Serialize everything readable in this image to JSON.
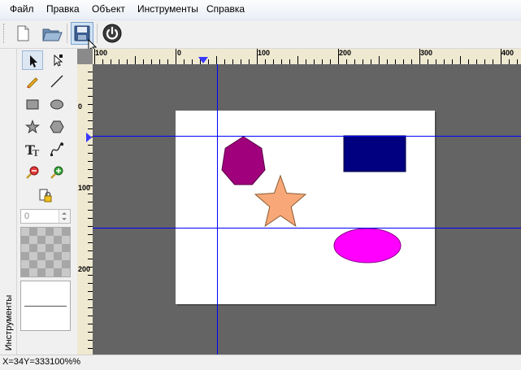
{
  "menu": {
    "items": [
      "Файл",
      "Правка",
      "Объект",
      "Инструменты",
      "Справка"
    ]
  },
  "toolbar": {
    "buttons": [
      {
        "name": "new-document-icon"
      },
      {
        "name": "open-folder-icon"
      },
      {
        "name": "save-icon",
        "state": "hovered"
      },
      {
        "name": "power-icon"
      }
    ]
  },
  "tools_panel": {
    "title": "Инструменты",
    "tools": [
      {
        "name": "select-arrow-icon",
        "selected": true
      },
      {
        "name": "node-select-icon"
      },
      {
        "name": "pencil-icon"
      },
      {
        "name": "line-icon"
      },
      {
        "name": "rectangle-icon"
      },
      {
        "name": "ellipse-icon"
      },
      {
        "name": "star-icon"
      },
      {
        "name": "polygon-icon"
      },
      {
        "name": "text-icon"
      },
      {
        "name": "bezier-icon"
      },
      {
        "name": "zoom-out-icon"
      },
      {
        "name": "zoom-in-icon"
      },
      {
        "name": "lock-icon"
      }
    ],
    "stroke_width_value": "0"
  },
  "rulers": {
    "horizontal_labels": [
      "100",
      "0",
      "100",
      "200",
      "300",
      "400"
    ],
    "vertical_labels": [
      "0",
      "100",
      "200"
    ]
  },
  "canvas": {
    "shapes": [
      {
        "type": "heptagon",
        "fill": "#a0007b"
      },
      {
        "type": "rectangle",
        "fill": "#000080"
      },
      {
        "type": "star",
        "fill": "#f8a878"
      },
      {
        "type": "ellipse",
        "fill": "#ff00ff"
      }
    ],
    "guide_color": "#0000ff"
  },
  "status": {
    "text": "X=34Y=333100%%"
  },
  "colors": {
    "canvas_background": "#646464",
    "ruler_background": "#efe9d2"
  }
}
